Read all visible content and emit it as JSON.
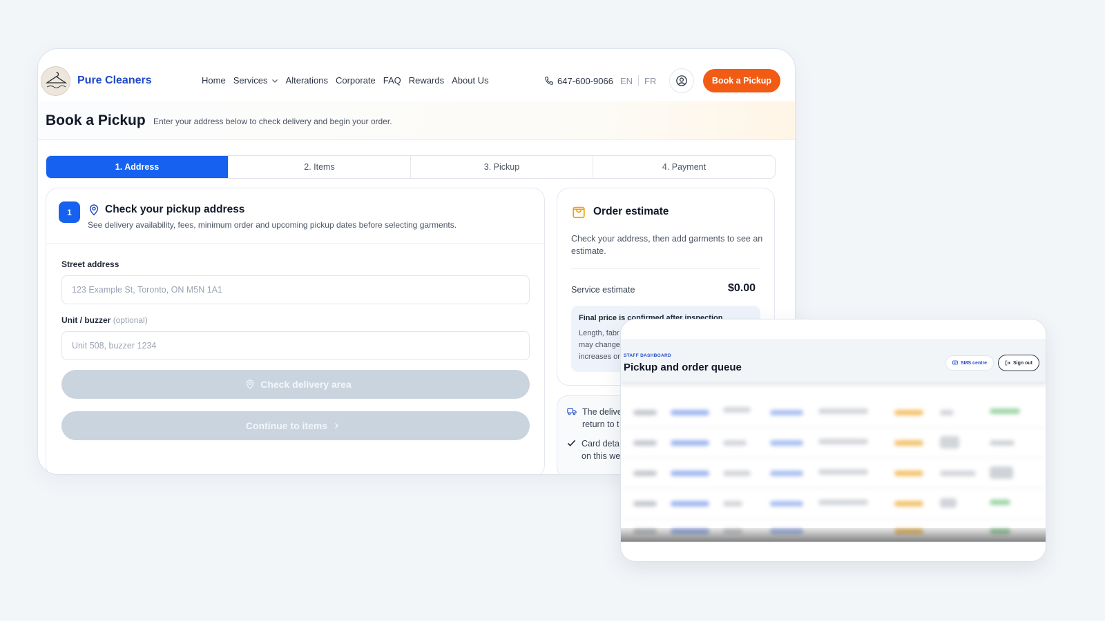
{
  "brand": {
    "name": "Pure Cleaners"
  },
  "nav": {
    "items": [
      "Home",
      "Services",
      "Alterations",
      "Corporate",
      "FAQ",
      "Rewards",
      "About Us"
    ],
    "phone": "647-600-9066",
    "lang_en": "EN",
    "lang_fr": "FR",
    "cta": "Book a Pickup"
  },
  "page": {
    "title": "Book a Pickup",
    "subtitle": "Enter your address below to check delivery and begin your order."
  },
  "steps": [
    "1. Address",
    "2. Items",
    "3. Pickup",
    "4. Payment"
  ],
  "address_card": {
    "step_number": "1",
    "title": "Check your pickup address",
    "subtitle": "See delivery availability, fees, minimum order and upcoming pickup dates before selecting garments.",
    "street_label": "Street address",
    "street_placeholder": "123 Example St, Toronto, ON M5N 1A1",
    "unit_label": "Unit / buzzer",
    "unit_optional": "(optional)",
    "unit_placeholder": "Unit 508, buzzer 1234",
    "check_button": "Check delivery area",
    "continue_button": "Continue to items"
  },
  "estimate": {
    "title": "Order estimate",
    "text": "Check your address, then add garments to see an estimate.",
    "service_label": "Service estimate",
    "service_value": "$0.00",
    "note_title": "Final price is confirmed after inspection",
    "note_line1": "Length, fabr",
    "note_line2": "may change",
    "note_line3": "increases or"
  },
  "info": {
    "line1a": "The delive",
    "line1b": "return to t",
    "line2a": "Card deta",
    "line2b": "on this we"
  },
  "dashboard": {
    "kicker": "STAFF DASHBOARD",
    "title": "Pickup and order queue",
    "sms_button": "SMS centre",
    "signout_button": "Sign out"
  },
  "colors": {
    "brand_blue": "#1f49c7",
    "step_active": "#1661f0",
    "cta_orange": "#f25b14",
    "disabled_button": "#c9d4df"
  }
}
